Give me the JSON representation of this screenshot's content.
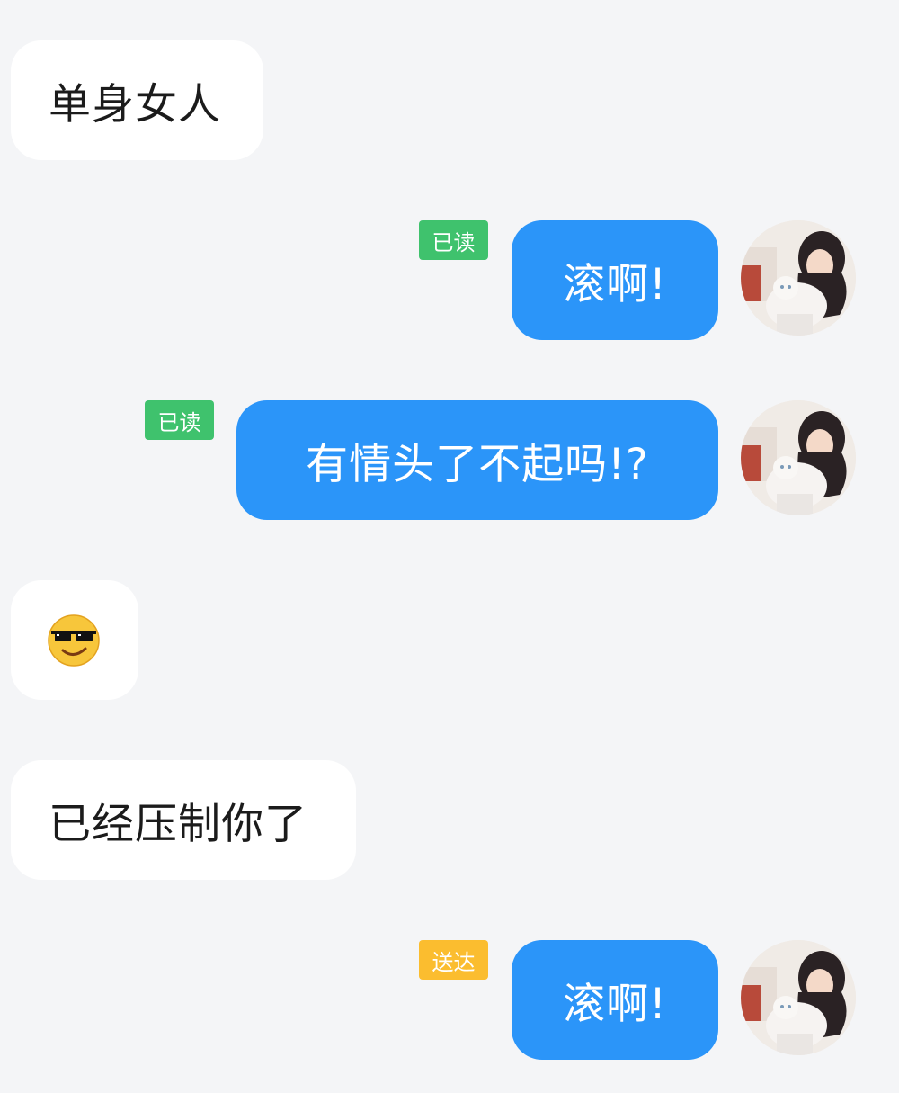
{
  "messages": [
    {
      "side": "in",
      "text": "单身女人"
    },
    {
      "side": "out",
      "text": "滚啊!",
      "status": "已读"
    },
    {
      "side": "out",
      "text": "有情头了不起吗!?",
      "status": "已读"
    },
    {
      "side": "in",
      "emoji": "sunglasses-smiling-face-emoji"
    },
    {
      "side": "in",
      "text": "已经压制你了"
    },
    {
      "side": "out",
      "text": "滚啊!",
      "status": "送达"
    }
  ],
  "colors": {
    "background": "#f4f5f7",
    "incoming_bubble": "#ffffff",
    "outgoing_bubble": "#2b95f9",
    "status_read": "#3fc26d",
    "status_delivered": "#fbbd2f"
  },
  "avatar_icon": "user-avatar-photo"
}
